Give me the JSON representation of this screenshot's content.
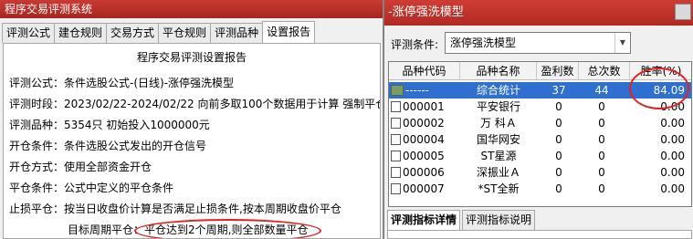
{
  "left_window": {
    "title": "程序交易评测系统",
    "tabs": [
      "评测公式",
      "建仓规则",
      "交易方式",
      "平仓规则",
      "评测品种",
      "设置报告"
    ],
    "active_tab": 5,
    "report": {
      "heading": "程序交易评测设置报告",
      "lines": [
        "评测公式：条件选股公式-(日线)-涨停强洗模型",
        "评测时段：2023/02/22-2024/02/22 向前多取100个数据用于计算 强制平仓",
        "评测品种：5354只 初始投入1000000元",
        "开仓条件：条件选股公式发出的开仓信号",
        "开仓方式：使用全部资金开仓",
        "平仓条件：公式中定义的平仓条件",
        "止损平仓：按当日收盘价计算是否满足止损条件,按本周期收盘价平仓",
        "目标周期平仓：平仓达到2个周期,则全部数量平仓"
      ]
    }
  },
  "right_window": {
    "title": "-涨停强洗模型",
    "condition_label": "评测条件:",
    "condition_value": "涨停强洗模型",
    "table": {
      "columns": [
        "品种代码",
        "品种名称",
        "盈利数",
        "总次数",
        "胜率(%)"
      ],
      "rows": [
        {
          "code": "------",
          "name": "综合统计",
          "profit": "37",
          "total": "44",
          "rate": "84.09"
        },
        {
          "code": "000001",
          "name": "平安银行",
          "profit": "0",
          "total": "0",
          "rate": "0.00"
        },
        {
          "code": "000002",
          "name": "万 科Ａ",
          "profit": "0",
          "total": "0",
          "rate": "0.00"
        },
        {
          "code": "000004",
          "name": "国华网安",
          "profit": "0",
          "total": "0",
          "rate": "0.00"
        },
        {
          "code": "000005",
          "name": "ST星源",
          "profit": "0",
          "total": "0",
          "rate": "0.00"
        },
        {
          "code": "000006",
          "name": "深振业Ａ",
          "profit": "0",
          "total": "0",
          "rate": "0.00"
        },
        {
          "code": "000007",
          "name": "*ST全新",
          "profit": "0",
          "total": "0",
          "rate": "0.00"
        }
      ]
    },
    "bottom_tabs": [
      "评测指标详情",
      "评测指标说明"
    ],
    "active_bottom_tab": 0
  },
  "colors": {
    "title_bar": "#b52e27",
    "selected_row": "#2f6fd0",
    "annotation_ellipse": "#e22222"
  }
}
